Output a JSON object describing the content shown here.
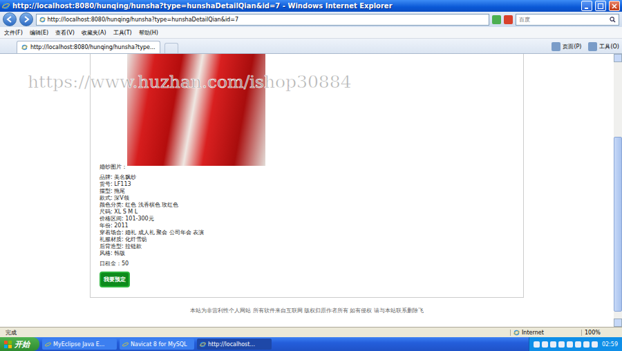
{
  "window": {
    "title": "http://localhost:8080/hunqing/hunsha?type=hunshaDetailQian&id=7 - Windows Internet Explorer"
  },
  "address": {
    "url": "http://localhost:8080/hunqing/hunsha?type=hunshaDetailQian&id=7",
    "search_placeholder": "百度"
  },
  "menu": [
    "文件(F)",
    "编辑(E)",
    "查看(V)",
    "收藏夹(A)",
    "工具(T)",
    "帮助(H)"
  ],
  "tabs": [
    {
      "label": "http://localhost:8080/hunqing/hunsha?type...",
      "selected": true
    }
  ],
  "toolbar": [
    "页面(P)",
    "工具(O)"
  ],
  "watermark": "https://www.huzhan.com/ishop30884",
  "detail": {
    "image_label": "婚纱图片：",
    "attributes": [
      "品牌: 美名飘纱",
      "货号: LF113",
      "摆型: 拖尾",
      "款式: 深V领",
      "颜色分类: 红色 浅香槟色 玫红色",
      "尺码: XL S M L",
      "价格区间: 101-300元",
      "年份: 2011",
      "穿着场合: 婚礼 成人礼 聚会 公司年会 表演",
      "礼服材质: 化纤雪纺",
      "后背造型: 拉链款",
      "风格: 韩版"
    ],
    "rent": "日租金：50",
    "button": "我要预定"
  },
  "footer": "本站为非营利性个人网站 所有软件来自互联网 版权归原作者所有 如有侵权 请与本站联系删除飞",
  "status_bar": {
    "text": "完成",
    "zone": "Internet",
    "zoom": "100%"
  },
  "taskbar": {
    "start": "开始",
    "tasks": [
      {
        "label": "MyEclipse Java E...",
        "selected": false
      },
      {
        "label": "Navicat 8 for MySQL",
        "selected": false
      },
      {
        "label": "http://localhost...",
        "selected": true
      }
    ],
    "clock": "02:59"
  }
}
